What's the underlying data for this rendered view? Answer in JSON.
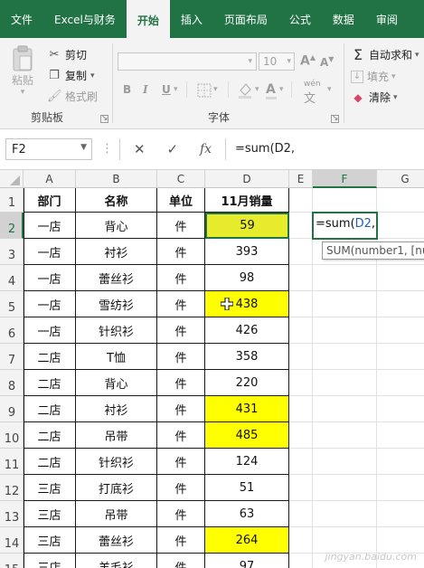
{
  "tabs": [
    {
      "label": "文件",
      "active": false
    },
    {
      "label": "Excel与财务",
      "active": false
    },
    {
      "label": "开始",
      "active": true
    },
    {
      "label": "插入",
      "active": false
    },
    {
      "label": "页面布局",
      "active": false
    },
    {
      "label": "公式",
      "active": false
    },
    {
      "label": "数据",
      "active": false
    },
    {
      "label": "审阅",
      "active": false
    }
  ],
  "ribbon": {
    "clipboard": {
      "paste": "粘贴",
      "cut": "剪切",
      "copy": "复制",
      "format_painter": "格式刷",
      "group_label": "剪贴板"
    },
    "font": {
      "font_size": "10",
      "bold": "B",
      "italic": "I",
      "underline": "U",
      "grow": "A",
      "shrink": "A",
      "phonetic": "wén",
      "group_label": "字体"
    },
    "editing": {
      "autosum": "自动求和",
      "fill": "填充",
      "clear": "清除"
    }
  },
  "formula_bar": {
    "name_box": "F2",
    "formula": "=sum(D2,",
    "cancel_icon": "close-icon",
    "enter_icon": "check-icon",
    "fx": "fx"
  },
  "columns": [
    "A",
    "B",
    "C",
    "D",
    "E",
    "F",
    "G"
  ],
  "row_numbers": [
    "1",
    "2",
    "3",
    "4",
    "5",
    "6",
    "7",
    "8",
    "9",
    "10",
    "11",
    "12",
    "13",
    "14",
    "15"
  ],
  "table": {
    "headers": [
      "部门",
      "名称",
      "单位",
      "11月销量"
    ],
    "rows": [
      {
        "dept": "一店",
        "name": "背心",
        "unit": "件",
        "qty": "59",
        "highlight": "selected"
      },
      {
        "dept": "一店",
        "name": "衬衫",
        "unit": "件",
        "qty": "393",
        "highlight": ""
      },
      {
        "dept": "一店",
        "name": "蕾丝衫",
        "unit": "件",
        "qty": "98",
        "highlight": ""
      },
      {
        "dept": "一店",
        "name": "雪纺衫",
        "unit": "件",
        "qty": "438",
        "highlight": "yellow"
      },
      {
        "dept": "一店",
        "name": "针织衫",
        "unit": "件",
        "qty": "426",
        "highlight": ""
      },
      {
        "dept": "二店",
        "name": "T恤",
        "unit": "件",
        "qty": "358",
        "highlight": ""
      },
      {
        "dept": "二店",
        "name": "背心",
        "unit": "件",
        "qty": "220",
        "highlight": ""
      },
      {
        "dept": "二店",
        "name": "衬衫",
        "unit": "件",
        "qty": "431",
        "highlight": "yellow"
      },
      {
        "dept": "二店",
        "name": "吊带",
        "unit": "件",
        "qty": "485",
        "highlight": "yellow"
      },
      {
        "dept": "二店",
        "name": "针织衫",
        "unit": "件",
        "qty": "124",
        "highlight": ""
      },
      {
        "dept": "三店",
        "name": "打底衫",
        "unit": "件",
        "qty": "51",
        "highlight": ""
      },
      {
        "dept": "三店",
        "name": "吊带",
        "unit": "件",
        "qty": "63",
        "highlight": ""
      },
      {
        "dept": "三店",
        "name": "蕾丝衫",
        "unit": "件",
        "qty": "264",
        "highlight": "yellow"
      },
      {
        "dept": "三店",
        "name": "羊毛衫",
        "unit": "件",
        "qty": "97",
        "highlight": ""
      }
    ]
  },
  "active_cell": {
    "ref": "F2",
    "text_prefix": "=sum(",
    "text_ref": "D2",
    "text_suffix": ","
  },
  "tooltip": {
    "text": "SUM(number1, [nu"
  },
  "watermark": "jingyan.baidu.com",
  "colors": {
    "tab_bar": "#217346",
    "highlight_yellow": "#ffff00",
    "selection_green": "#217346"
  }
}
